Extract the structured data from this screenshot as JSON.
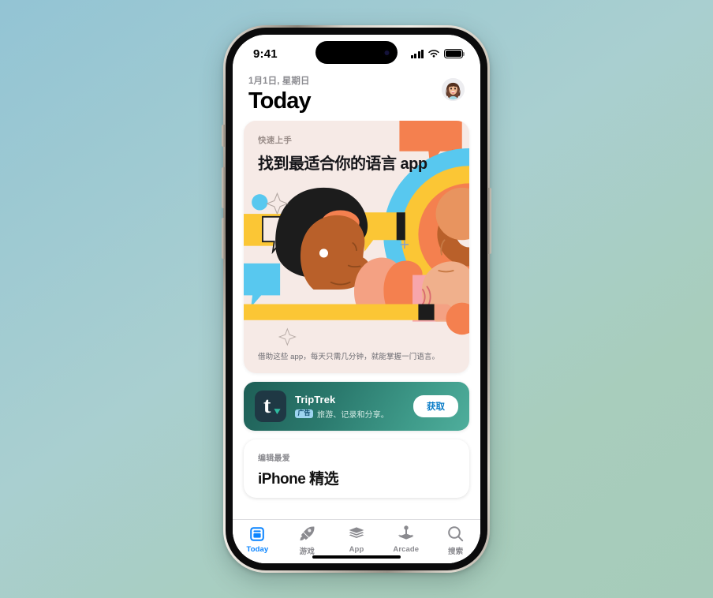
{
  "background": {
    "gradient_from": "#93c4d4",
    "gradient_to": "#a6cbba"
  },
  "device": {
    "name": "iPhone",
    "frame_color": "#c8c1b6",
    "buttons": [
      "silence-switch",
      "volume-up",
      "volume-down",
      "power"
    ]
  },
  "status_bar": {
    "time": "9:41",
    "signal_icon": "cellular-bars-icon",
    "signal_bars": 4,
    "wifi_icon": "wifi-icon",
    "battery_icon": "battery-full-icon",
    "battery_level": 100,
    "dynamic_island": "dynamic-island"
  },
  "header": {
    "date": "1月1日, 星期日",
    "title": "Today",
    "avatar_label": "个人资料"
  },
  "feed": {
    "featured_card": {
      "eyebrow": "快速上手",
      "title": "找到最适合你的语言 app",
      "caption": "借助这些 app，每天只需几分钟，就能掌握一门语言。",
      "background_color": "#f6eae6",
      "artwork_name": "language-conversation-illustration",
      "artwork_colors": {
        "orange": "#f4804f",
        "yellow": "#fbc635",
        "cyan": "#58c8ef",
        "pink": "#f7a6ab",
        "salmon": "#f4a183",
        "brown": "#b9602a",
        "skin": "#e8945f",
        "black": "#1c1c1c",
        "cream": "#f6eae6"
      }
    },
    "ad_card": {
      "app_name": "TripTrek",
      "badge": "广告",
      "description": "旅游、记录和分享。",
      "button_label": "获取",
      "icon_name": "triptrek-app-icon",
      "icon_glyph": "t",
      "gradient_from": "#1e5e56",
      "gradient_to": "#4fae9c",
      "button_text_color": "#0a7cc7"
    },
    "editors_card": {
      "eyebrow": "编辑最爱",
      "title": "iPhone 精选",
      "background_color": "#ffffff"
    }
  },
  "tab_bar": {
    "active_color": "#0a84ff",
    "inactive_color": "#8a8a8f",
    "tabs": [
      {
        "label": "Today",
        "icon": "today-card-icon",
        "active": true
      },
      {
        "label": "游戏",
        "icon": "rocket-icon",
        "active": false
      },
      {
        "label": "App",
        "icon": "layers-stack-icon",
        "active": false
      },
      {
        "label": "Arcade",
        "icon": "joystick-icon",
        "active": false
      },
      {
        "label": "搜索",
        "icon": "search-icon",
        "active": false
      }
    ]
  },
  "home_indicator": "home-indicator-bar"
}
